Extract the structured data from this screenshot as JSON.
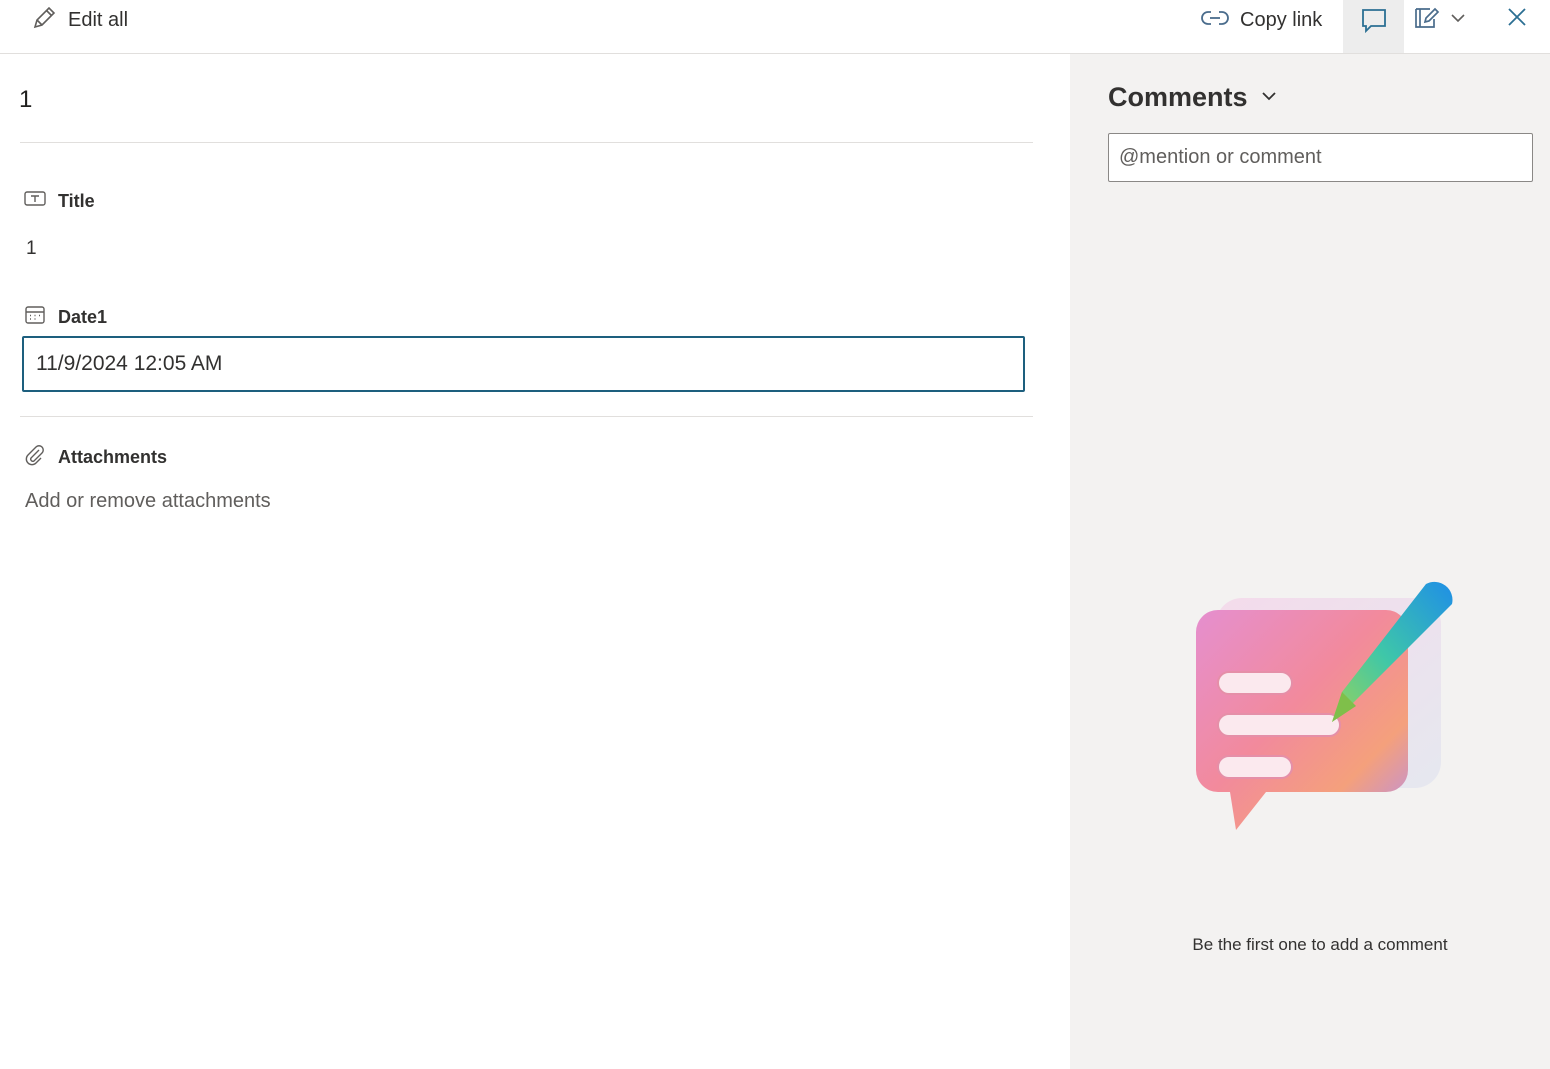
{
  "toolbar": {
    "edit_all_label": "Edit all",
    "edit_all_icon": "pencil-icon",
    "copy_link_label": "Copy link",
    "copy_link_icon": "link-icon",
    "comments_toggle_icon": "comment-icon",
    "form_menu_icon": "form-edit-icon",
    "close_icon": "close-icon"
  },
  "item": {
    "title": "1",
    "fields": {
      "title": {
        "label": "Title",
        "value": "1",
        "icon": "text-field-icon"
      },
      "date1": {
        "label": "Date1",
        "value": "11/9/2024 12:05 AM",
        "icon": "calendar-icon"
      },
      "attachments": {
        "label": "Attachments",
        "link": "Add or remove attachments",
        "icon": "paperclip-icon"
      }
    }
  },
  "comments": {
    "header": "Comments",
    "placeholder": "@mention or comment",
    "empty_message": "Be the first one to add a comment",
    "illustration_icon": "comment-illustration-icon"
  },
  "colors": {
    "accent": "#1d5f7e",
    "panel_bg": "#f3f2f1",
    "text": "#323130"
  }
}
